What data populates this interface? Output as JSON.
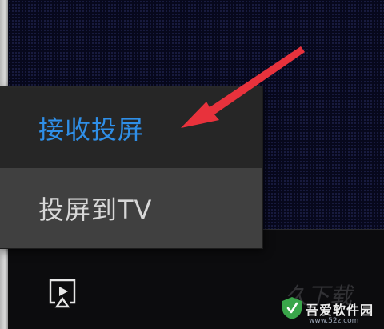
{
  "menu": {
    "items": [
      {
        "label": "接收投屏",
        "color": "#2f8fe8",
        "state": "highlighted"
      },
      {
        "label": "投屏到TV",
        "color": "#d8d8d8",
        "state": "hover"
      }
    ]
  },
  "annotation": {
    "arrow_color": "#e8323c",
    "icon": "arrow-annotation-icon"
  },
  "toolbar": {
    "cast_icon": "screen-cast-icon"
  },
  "watermark": {
    "ghost_text": "久下载",
    "title": "吾爱软件园",
    "url": "www.52z.com",
    "icon": "watermark-logo-icon"
  }
}
